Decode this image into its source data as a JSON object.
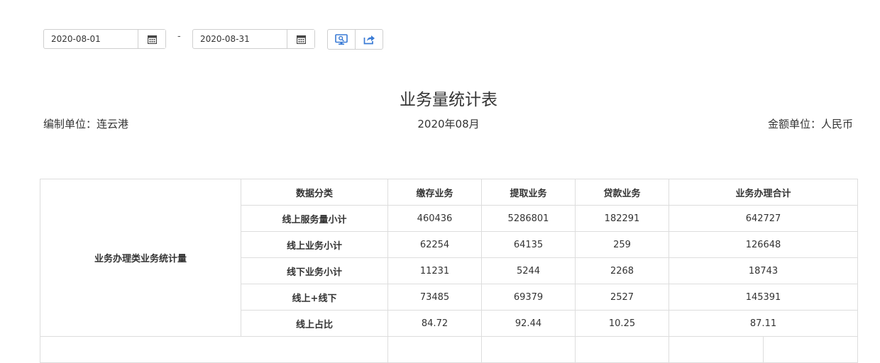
{
  "filters": {
    "start_date": "2020-08-01",
    "end_date": "2020-08-31",
    "separator": "-"
  },
  "toolbar": {
    "query_icon": "monitor-search-icon",
    "export_icon": "share-export-icon",
    "accent_color": "#3a7bd5"
  },
  "report": {
    "title": "业务量统计表",
    "unit_left": "编制单位：连云港",
    "period": "2020年08月",
    "unit_right": "金额单位：人民币"
  },
  "table": {
    "group_label": "业务办理类业务统计量",
    "headers": [
      "数据分类",
      "缴存业务",
      "提取业务",
      "贷款业务",
      "业务办理合计"
    ],
    "rows": [
      {
        "label": "线上服务量小计",
        "values": [
          "460436",
          "5286801",
          "182291",
          "642727"
        ]
      },
      {
        "label": "线上业务小计",
        "values": [
          "62254",
          "64135",
          "259",
          "126648"
        ]
      },
      {
        "label": "线下业务小计",
        "values": [
          "11231",
          "5244",
          "2268",
          "18743"
        ]
      },
      {
        "label": "线上+线下",
        "values": [
          "73485",
          "69379",
          "2527",
          "145391"
        ]
      },
      {
        "label": "线上占比",
        "values": [
          "84.72",
          "92.44",
          "10.25",
          "87.11"
        ]
      }
    ]
  }
}
